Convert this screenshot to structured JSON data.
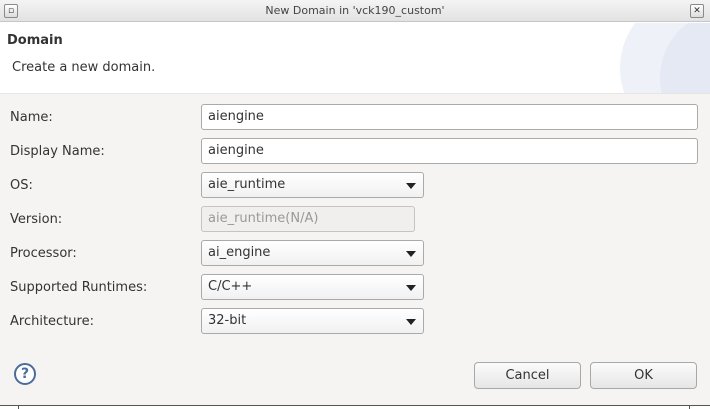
{
  "window": {
    "title": "New Domain in 'vck190_custom'"
  },
  "header": {
    "title": "Domain",
    "description": "Create a new domain."
  },
  "form": {
    "name": {
      "label": "Name:",
      "value": "aiengine"
    },
    "display_name": {
      "label": "Display Name:",
      "value": "aiengine"
    },
    "os": {
      "label": "OS:",
      "value": "aie_runtime"
    },
    "version": {
      "label": "Version:",
      "value": "aie_runtime(N/A)"
    },
    "processor": {
      "label": "Processor:",
      "value": "ai_engine"
    },
    "supported_runtimes": {
      "label": "Supported Runtimes:",
      "value": "C/C++"
    },
    "architecture": {
      "label": "Architecture:",
      "value": "32-bit"
    }
  },
  "buttons": {
    "help": "?",
    "cancel": "Cancel",
    "ok": "OK"
  },
  "icons": {
    "window_menu": "window-menu-icon",
    "close": "close-icon",
    "help": "help-icon",
    "dropdown": "chevron-down-icon"
  }
}
